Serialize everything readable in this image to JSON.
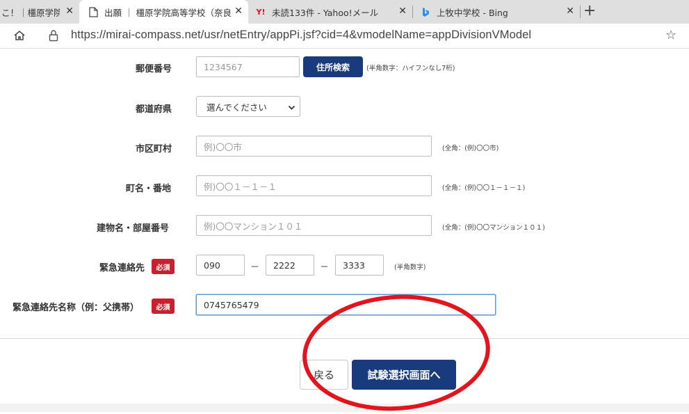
{
  "browser": {
    "tabs": [
      {
        "title": "こ！｜橿原学院高"
      },
      {
        "title": "出願 ｜ 橿原学院高等学校（奈良"
      },
      {
        "title": "未読133件 - Yahoo!メール"
      },
      {
        "title": "上牧中学校 - Bing"
      }
    ],
    "url": "https://mirai-compass.net/usr/netEntry/appPi.jsf?cid=4&vmodelName=appDivisionVModel",
    "colors": {
      "yahoo": "#ff0033",
      "bing": "#258ffa"
    }
  },
  "form": {
    "required_badge": "必須",
    "postal": {
      "label": "郵便番号",
      "placeholder": "1234567",
      "button": "住所検索",
      "hint": "(半角数字：ハイフンなし7桁)"
    },
    "prefecture": {
      "label": "都道府県",
      "selected": "選んでください"
    },
    "city": {
      "label": "市区町村",
      "placeholder": "例)〇〇市",
      "hint": "(全角：(例)〇〇市)"
    },
    "street": {
      "label": "町名・番地",
      "placeholder": "例)〇〇１－１－１",
      "hint": "(全角：(例)〇〇１－１－１)"
    },
    "building": {
      "label": "建物名・部屋番号",
      "placeholder": "例)〇〇マンション１０１",
      "hint": "(全角：(例)〇〇マンション１０１)"
    },
    "emergency": {
      "label": "緊急連絡先",
      "part1": "090",
      "part2": "2222",
      "part3": "3333",
      "dash": "－",
      "hint": "(半角数字)"
    },
    "emergency_name": {
      "label": "緊急連絡先名称（例：父携帯）",
      "value": "0745765479"
    }
  },
  "actions": {
    "back": "戻る",
    "next": "試験選択画面へ"
  },
  "colors": {
    "primary": "#1a3a7e",
    "required": "#c8202f",
    "annotation": "#e3141c"
  }
}
